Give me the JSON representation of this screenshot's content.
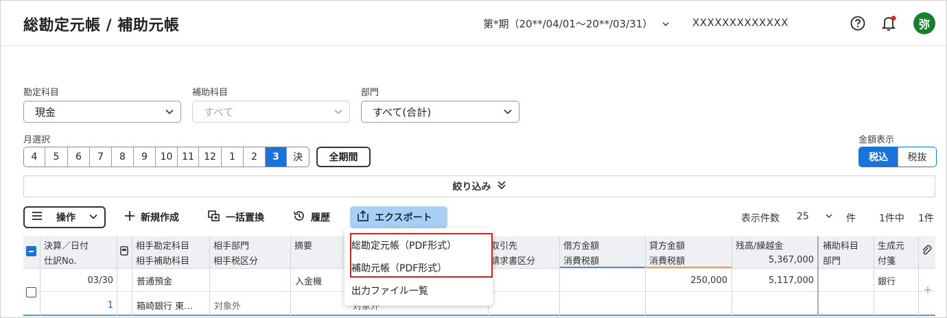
{
  "header": {
    "title": "総勘定元帳 / 補助元帳",
    "period": "第*期（20**/04/01〜20**/03/31）",
    "company": "XXXXXXXXXXXXX",
    "avatar_char": "弥",
    "avatar_color": "#1a7f2c"
  },
  "filters": {
    "account_label": "勘定科目",
    "account_value": "現金",
    "sub_account_label": "補助科目",
    "sub_account_value": "すべて",
    "dept_label": "部門",
    "dept_value": "すべて(合計)",
    "month_label": "月選択",
    "months": [
      "4",
      "5",
      "6",
      "7",
      "8",
      "9",
      "10",
      "11",
      "12",
      "1",
      "2",
      "3",
      "決"
    ],
    "active_month": "3",
    "all_period": "全期間",
    "amount_label": "金額表示",
    "amount_options": [
      "税込",
      "税抜"
    ],
    "amount_active": "税込",
    "narrow": "絞り込み"
  },
  "toolbar": {
    "operation": "操作",
    "new": "新規作成",
    "replace": "一括置換",
    "history": "履歴",
    "export": "エクスポート",
    "per_page_label": "表示件数",
    "per_page_value": "25",
    "per_page_unit": "件",
    "count": "1件中",
    "count_value": "1件"
  },
  "export_menu": {
    "items": [
      "総勘定元帳（PDF形式）",
      "補助元帳（PDF形式）",
      "出力ファイル一覧"
    ]
  },
  "table": {
    "headers_top": [
      "決算／日付",
      "相手勘定科目",
      "相手部門",
      "摘要",
      "取引先",
      "借方金額",
      "貸方金額",
      "残高/繰越金",
      "補助科目",
      "生成元"
    ],
    "headers_bottom": [
      "仕訳No.",
      "相手補助科目",
      "相手税区分",
      "請求書区分",
      "消費税額",
      "消費税額",
      "5,367,000",
      "部門",
      "付箋"
    ],
    "row": {
      "date": "03/30",
      "no": "1",
      "counter_account": "普通預金",
      "counter_sub": "箱崎銀行 東…",
      "tax_class": "対象外",
      "summary": "入金機",
      "summary_tax": "対象外",
      "credit": "250,000",
      "balance": "5,117,000",
      "source": "銀行"
    }
  },
  "colors": {
    "accent": "#1a73d9",
    "export_bg": "#a9cff5",
    "highlight": "#d62020",
    "debit_bar": "#6b84c9",
    "credit_bar": "#e9a15a"
  }
}
